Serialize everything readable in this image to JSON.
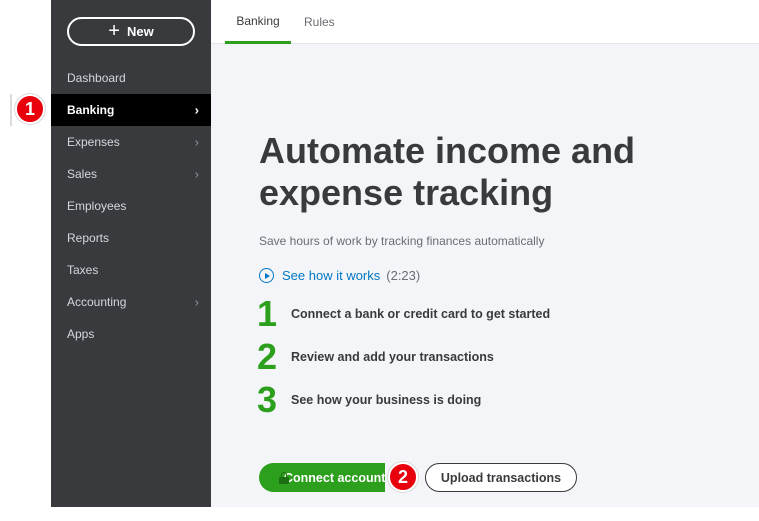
{
  "sidebar": {
    "new_button": "New",
    "items": [
      {
        "label": "Dashboard",
        "chevron": false,
        "active": false
      },
      {
        "label": "Banking",
        "chevron": true,
        "active": true
      },
      {
        "label": "Expenses",
        "chevron": true,
        "active": false
      },
      {
        "label": "Sales",
        "chevron": true,
        "active": false
      },
      {
        "label": "Employees",
        "chevron": false,
        "active": false
      },
      {
        "label": "Reports",
        "chevron": false,
        "active": false
      },
      {
        "label": "Taxes",
        "chevron": false,
        "active": false
      },
      {
        "label": "Accounting",
        "chevron": true,
        "active": false
      },
      {
        "label": "Apps",
        "chevron": false,
        "active": false
      }
    ]
  },
  "markers": {
    "first": "1",
    "second": "2"
  },
  "tabs": [
    {
      "label": "Banking",
      "active": true
    },
    {
      "label": "Rules",
      "active": false
    }
  ],
  "main": {
    "headline": "Automate income and expense tracking",
    "subtitle": "Save hours of work by tracking finances automatically",
    "howto_link": "See how it works",
    "howto_duration": "(2:23)",
    "steps": [
      {
        "number": "1",
        "text": "Connect a bank or credit card to get started"
      },
      {
        "number": "2",
        "text": "Review and add your transactions"
      },
      {
        "number": "3",
        "text": "See how your business is doing"
      }
    ],
    "connect_button": "Connect account",
    "upload_button": "Upload transactions"
  },
  "colors": {
    "sidebar_bg": "#393a3d",
    "active_nav_bg": "#000000",
    "accent_green": "#2ca01c",
    "link_blue": "#0077c5",
    "marker_red": "#e8000d"
  },
  "icons": {
    "new": "plus-icon",
    "nav_expand": "chevron-right-icon",
    "video": "play-circle-icon",
    "connect": "lock-icon"
  }
}
